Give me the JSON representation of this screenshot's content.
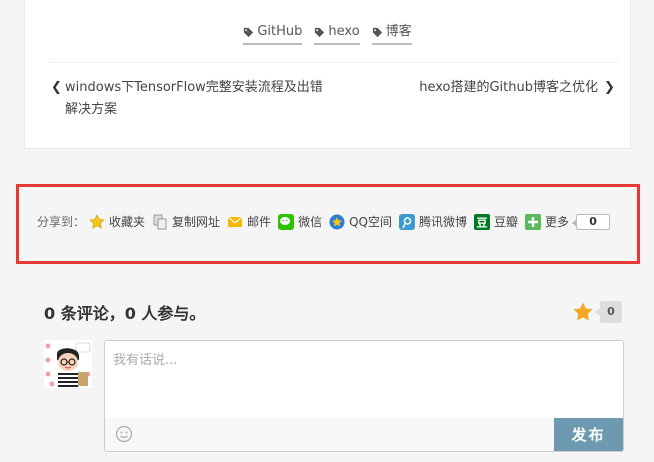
{
  "post": {
    "tags": [
      {
        "label": "GitHub"
      },
      {
        "label": "hexo"
      },
      {
        "label": "博客"
      }
    ],
    "prev_post": "windows下TensorFlow完整安装流程及出错解决方案",
    "next_post": "hexo搭建的Github博客之优化"
  },
  "share": {
    "label": "分享到：",
    "items": [
      {
        "label": "收藏夹",
        "icon": "star-icon"
      },
      {
        "label": "复制网址",
        "icon": "copy-icon"
      },
      {
        "label": "邮件",
        "icon": "mail-icon"
      },
      {
        "label": "微信",
        "icon": "wechat-icon"
      },
      {
        "label": "QQ空间",
        "icon": "qzone-icon"
      },
      {
        "label": "腾讯微博",
        "icon": "tencent-weibo-icon"
      },
      {
        "label": "豆瓣",
        "icon": "douban-icon"
      },
      {
        "label": "更多",
        "icon": "plus-icon"
      }
    ],
    "count": "0"
  },
  "comments": {
    "title": "0 条评论，0 人参与。",
    "rating_count": "0",
    "placeholder": "我有话说...",
    "submit_label": "发布"
  },
  "colors": {
    "highlight_border": "#e53935",
    "submit_bg": "#6d9ab1",
    "star": "#f5a623"
  }
}
